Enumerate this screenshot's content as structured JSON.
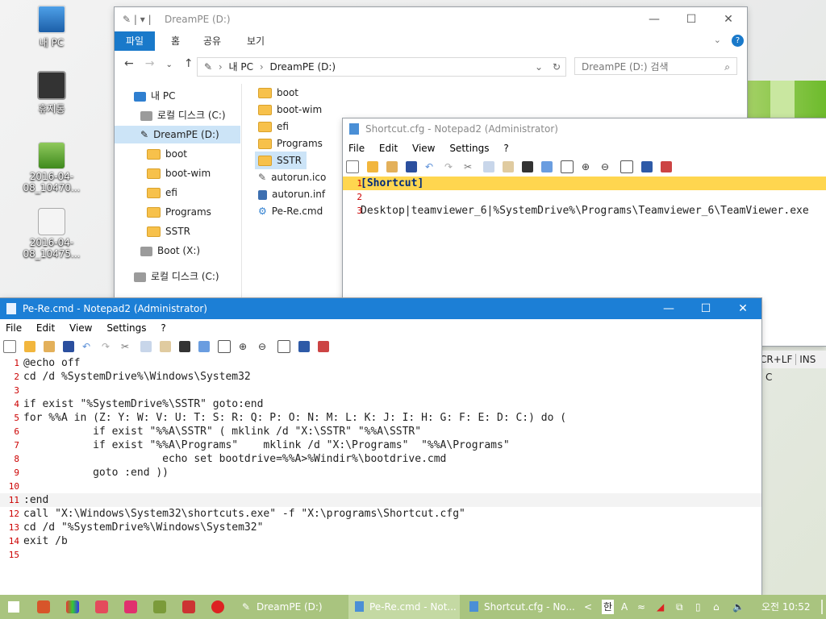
{
  "desktop": {
    "icons": [
      {
        "label": "내 PC",
        "name": "my-pc"
      },
      {
        "label": "휴지통",
        "name": "recycle-bin"
      },
      {
        "label": "2016-04-08_10470...",
        "name": "screenshot-file-1"
      },
      {
        "label": "2016-04-08_10475...",
        "name": "screenshot-file-2"
      }
    ]
  },
  "explorer": {
    "title": "DreamPE (D:)",
    "tabs": [
      "파일",
      "홈",
      "공유",
      "보기"
    ],
    "address": [
      "내 PC",
      "DreamPE (D:)"
    ],
    "search_placeholder": "DreamPE (D:) 검색",
    "nav": [
      "내 PC",
      "로컬 디스크 (C:)",
      "DreamPE (D:)",
      "boot",
      "boot-wim",
      "efi",
      "Programs",
      "SSTR",
      "Boot (X:)",
      "로컬 디스크 (C:)"
    ],
    "files": [
      "boot",
      "boot-wim",
      "efi",
      "Programs",
      "SSTR",
      "autorun.ico",
      "autorun.inf",
      "Pe-Re.cmd"
    ]
  },
  "notepad_shortcut": {
    "title": "Shortcut.cfg - Notepad2 (Administrator)",
    "menu": [
      "File",
      "Edit",
      "View",
      "Settings",
      "?"
    ],
    "lines": [
      "[Shortcut]",
      "",
      "Desktop|teamviewer_6|%SystemDrive%\\Programs\\Teamviewer_6\\TeamViewer.exe"
    ],
    "status_partial": [
      "CR+LF",
      "INS",
      "C"
    ]
  },
  "notepad_main": {
    "title": "Pe-Re.cmd - Notepad2 (Administrator)",
    "menu": [
      "File",
      "Edit",
      "View",
      "Settings",
      "?"
    ],
    "lines": [
      "@echo off",
      "cd /d %SystemDrive%\\Windows\\System32",
      "",
      "if exist \"%SystemDrive%\\SSTR\" goto:end",
      "for %%A in (Z: Y: W: V: U: T: S: R: Q: P: O: N: M: L: K: J: I: H: G: F: E: D: C:) do (",
      "           if exist \"%%A\\SSTR\" ( mklink /d \"X:\\SSTR\" \"%%A\\SSTR\"",
      "           if exist \"%%A\\Programs\"    mklink /d \"X:\\Programs\"  \"%%A\\Programs\"",
      "                      echo set bootdrive=%%A>%Windir%\\bootdrive.cmd",
      "           goto :end ))",
      "",
      ":end",
      "call \"X:\\Windows\\System32\\shortcuts.exe\" -f \"X:\\programs\\Shortcut.cfg\"",
      "cd /d \"%SystemDrive%\\Windows\\System32\"",
      "exit /b",
      ""
    ]
  },
  "taskbar": {
    "items": [
      "DreamPE (D:)",
      "Pe-Re.cmd - Not...",
      "Shortcut.cfg - No..."
    ],
    "clock": "오전 10:52",
    "ime": "한"
  },
  "colors": {
    "accent": "#1979ca",
    "titlebar_active": "#1c7fd6",
    "taskbar": "#a9c47f",
    "current_line": "#ffd64f"
  }
}
